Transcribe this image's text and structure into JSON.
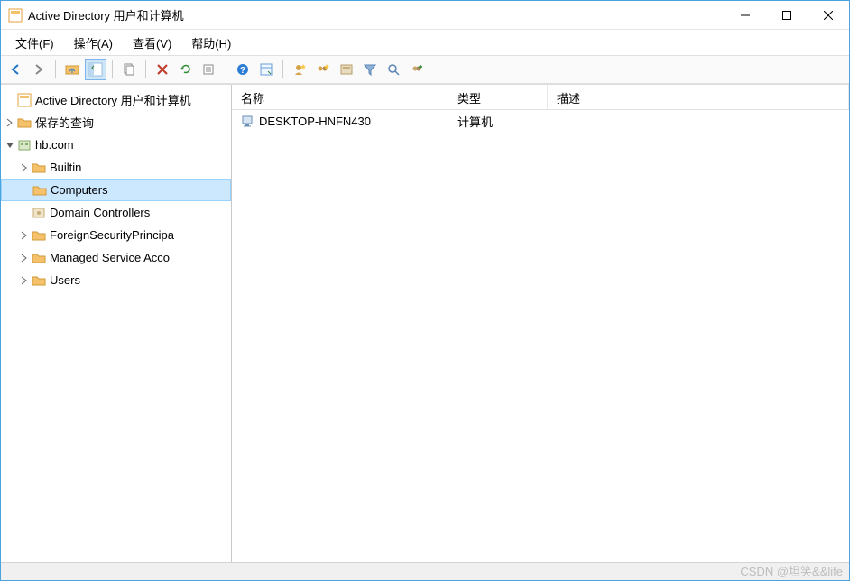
{
  "window": {
    "title": "Active Directory 用户和计算机"
  },
  "menubar": {
    "items": [
      {
        "label": "文件(F)"
      },
      {
        "label": "操作(A)"
      },
      {
        "label": "查看(V)"
      },
      {
        "label": "帮助(H)"
      }
    ]
  },
  "tree": {
    "root": {
      "label": "Active Directory 用户和计算机"
    },
    "saved_queries": {
      "label": "保存的查询"
    },
    "domain": {
      "label": "hb.com",
      "children": {
        "builtin": "Builtin",
        "computers": "Computers",
        "domain_controllers": "Domain Controllers",
        "fsp": "ForeignSecurityPrincipa",
        "msa": "Managed Service Acco",
        "users": "Users"
      }
    }
  },
  "list": {
    "columns": {
      "name": "名称",
      "type": "类型",
      "description": "描述"
    },
    "rows": [
      {
        "name": "DESKTOP-HNFN430",
        "type": "计算机",
        "description": ""
      }
    ]
  },
  "watermark": "CSDN @坦笑&&life"
}
